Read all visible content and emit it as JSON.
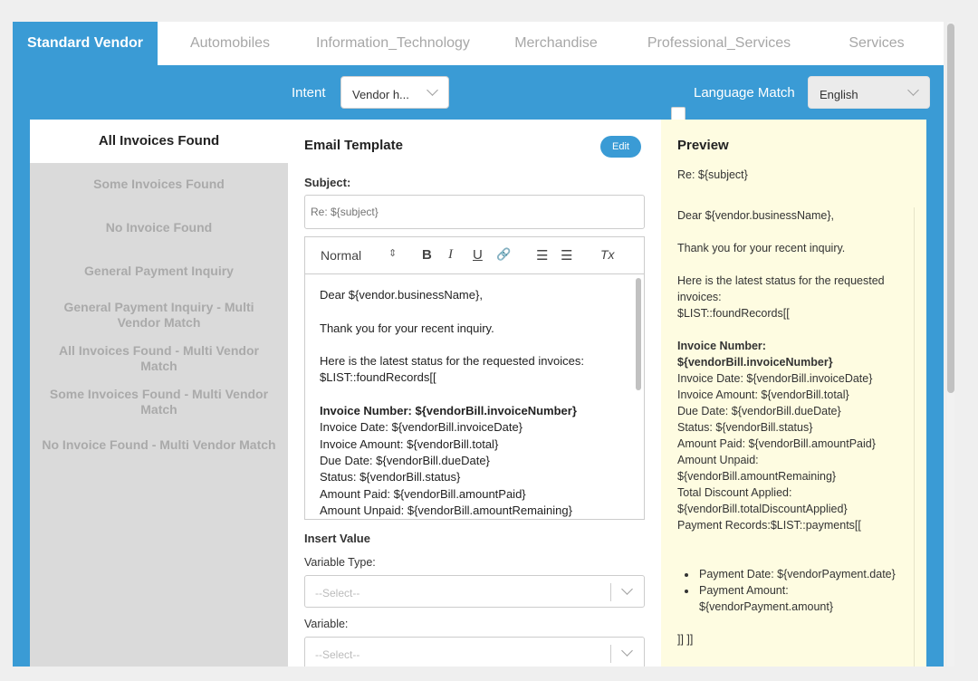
{
  "tabs": [
    {
      "label": "Standard Vendor",
      "active": true
    },
    {
      "label": "Automobiles",
      "active": false
    },
    {
      "label": "Information_Technology",
      "active": false
    },
    {
      "label": "Merchandise",
      "active": false
    },
    {
      "label": "Professional_Services",
      "active": false
    },
    {
      "label": "Services",
      "active": false
    }
  ],
  "intent": {
    "label": "Intent",
    "value": "Vendor h..."
  },
  "language": {
    "checkbox_label": "Language Match",
    "checked": false,
    "value": "English"
  },
  "scenarios": [
    "All Invoices Found",
    "Some Invoices Found",
    "No Invoice Found",
    "General Payment Inquiry",
    "General Payment Inquiry - Multi Vendor Match",
    "All Invoices Found - Multi Vendor Match",
    "Some Invoices Found - Multi Vendor Match",
    "No Invoice Found - Multi Vendor Match"
  ],
  "email_template": {
    "title": "Email Template",
    "edit_label": "Edit",
    "subject_label": "Subject:",
    "subject_placeholder": "Re: ${subject}",
    "toolbar": {
      "format": "Normal",
      "format_arrow": "⇕",
      "bold": "B",
      "italic": "I",
      "underline": "U",
      "link": "🔗",
      "ordered_list": "☰",
      "bullet_list": "☰",
      "clear": "Tx"
    },
    "body": [
      "Dear ${vendor.businessName},",
      "",
      "Thank you for your recent inquiry.",
      "",
      "Here is the latest status for the requested invoices:",
      "$LIST::foundRecords[[",
      "",
      "Invoice Number: ${vendorBill.invoiceNumber}",
      "Invoice Date: ${vendorBill.invoiceDate}",
      "Invoice Amount: ${vendorBill.total}",
      "Due Date: ${vendorBill.dueDate}",
      "Status: ${vendorBill.status}",
      "Amount Paid: ${vendorBill.amountPaid}",
      "Amount Unpaid: ${vendorBill.amountRemaining}"
    ]
  },
  "insert_value": {
    "title": "Insert Value",
    "variable_type_label": "Variable Type:",
    "variable_type_placeholder": "--Select--",
    "variable_label": "Variable:",
    "variable_placeholder": "--Select--"
  },
  "preview": {
    "title": "Preview",
    "subject": "Re: ${subject}",
    "body": [
      "Dear ${vendor.businessName},",
      "",
      "Thank you for your recent inquiry.",
      "",
      "Here is the latest status for the requested invoices:",
      "$LIST::foundRecords[[",
      "",
      "Invoice Number:",
      "${vendorBill.invoiceNumber}",
      "Invoice Date: ${vendorBill.invoiceDate}",
      "Invoice Amount: ${vendorBill.total}",
      "Due Date: ${vendorBill.dueDate}",
      "Status: ${vendorBill.status}",
      "Amount Paid: ${vendorBill.amountPaid}",
      "Amount Unpaid:",
      "${vendorBill.amountRemaining}",
      "Total Discount Applied:",
      "${vendorBill.totalDiscountApplied}",
      "Payment Records:$LIST::payments[["
    ],
    "bullets": [
      "Payment Date: ${vendorPayment.date}",
      "Payment Amount: ${vendorPayment.amount}"
    ],
    "closing": "]] ]]"
  },
  "colors": {
    "primary": "#3a9bd5",
    "preview_bg": "#fefce1",
    "nav_bg": "#dadada"
  }
}
